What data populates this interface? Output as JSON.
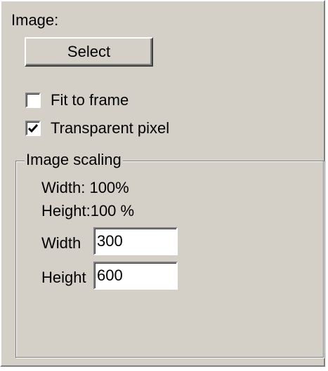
{
  "image_section": {
    "title": "Image:",
    "select_button": "Select"
  },
  "options": {
    "fit_to_frame": {
      "label": "Fit to frame",
      "checked": false
    },
    "transparent_pixel": {
      "label": "Transparent pixel",
      "checked": true
    }
  },
  "image_scaling": {
    "title": "Image scaling",
    "width_percent_label": "Width: 100%",
    "height_percent_label": "Height:100 %",
    "width_label": "Width",
    "width_value": "300",
    "height_label": "Height",
    "height_value": "600"
  },
  "colors": {
    "panel_bg": "#d4d0c8",
    "field_bg": "#ffffff"
  },
  "icons": {
    "checkmark": "checkmark-icon"
  }
}
